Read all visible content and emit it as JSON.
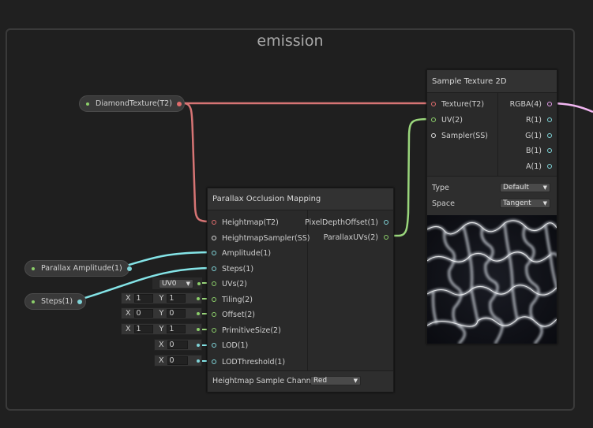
{
  "group": {
    "title": "emission"
  },
  "properties": {
    "diamond": {
      "label": "DiamondTexture(T2)"
    },
    "amplitude": {
      "label": "Parallax Amplitude(1)"
    },
    "steps": {
      "label": "Steps(1)"
    }
  },
  "pom": {
    "title": "Parallax Occlusion Mapping",
    "inputs": [
      "Heightmap(T2)",
      "HeightmapSampler(SS)",
      "Amplitude(1)",
      "Steps(1)",
      "UVs(2)",
      "Tiling(2)",
      "Offset(2)",
      "PrimitiveSize(2)",
      "LOD(1)",
      "LODThreshold(1)"
    ],
    "outputs": [
      "PixelDepthOffset(1)",
      "ParallaxUVs(2)"
    ],
    "uv_dropdown": "UV0",
    "tiling": {
      "x_label": "X",
      "x": "1",
      "y_label": "Y",
      "y": "1"
    },
    "offset": {
      "x_label": "X",
      "x": "0",
      "y_label": "Y",
      "y": "0"
    },
    "primitive": {
      "x_label": "X",
      "x": "1",
      "y_label": "Y",
      "y": "1"
    },
    "lod": {
      "x_label": "X",
      "x": "0"
    },
    "lodthreshold": {
      "x_label": "X",
      "x": "0"
    },
    "footer_label": "Heightmap Sample Channel",
    "footer_value": "Red"
  },
  "sample": {
    "title": "Sample Texture 2D",
    "inputs": [
      "Texture(T2)",
      "UV(2)",
      "Sampler(SS)"
    ],
    "outputs": [
      "RGBA(4)",
      "R(1)",
      "G(1)",
      "B(1)",
      "A(1)"
    ],
    "type_label": "Type",
    "type_value": "Default",
    "space_label": "Space",
    "space_value": "Tangent"
  },
  "colors": {
    "texture_wire": "#d67474",
    "vector1_wire": "#84e4e7",
    "vector2_wire": "#9ad67c",
    "vector4_wire": "#f2b6f2",
    "port_green": "#8ccf6a",
    "port_red": "#e06c6c",
    "port_cyan": "#7fd4d8",
    "port_pink": "#e19ae8"
  }
}
